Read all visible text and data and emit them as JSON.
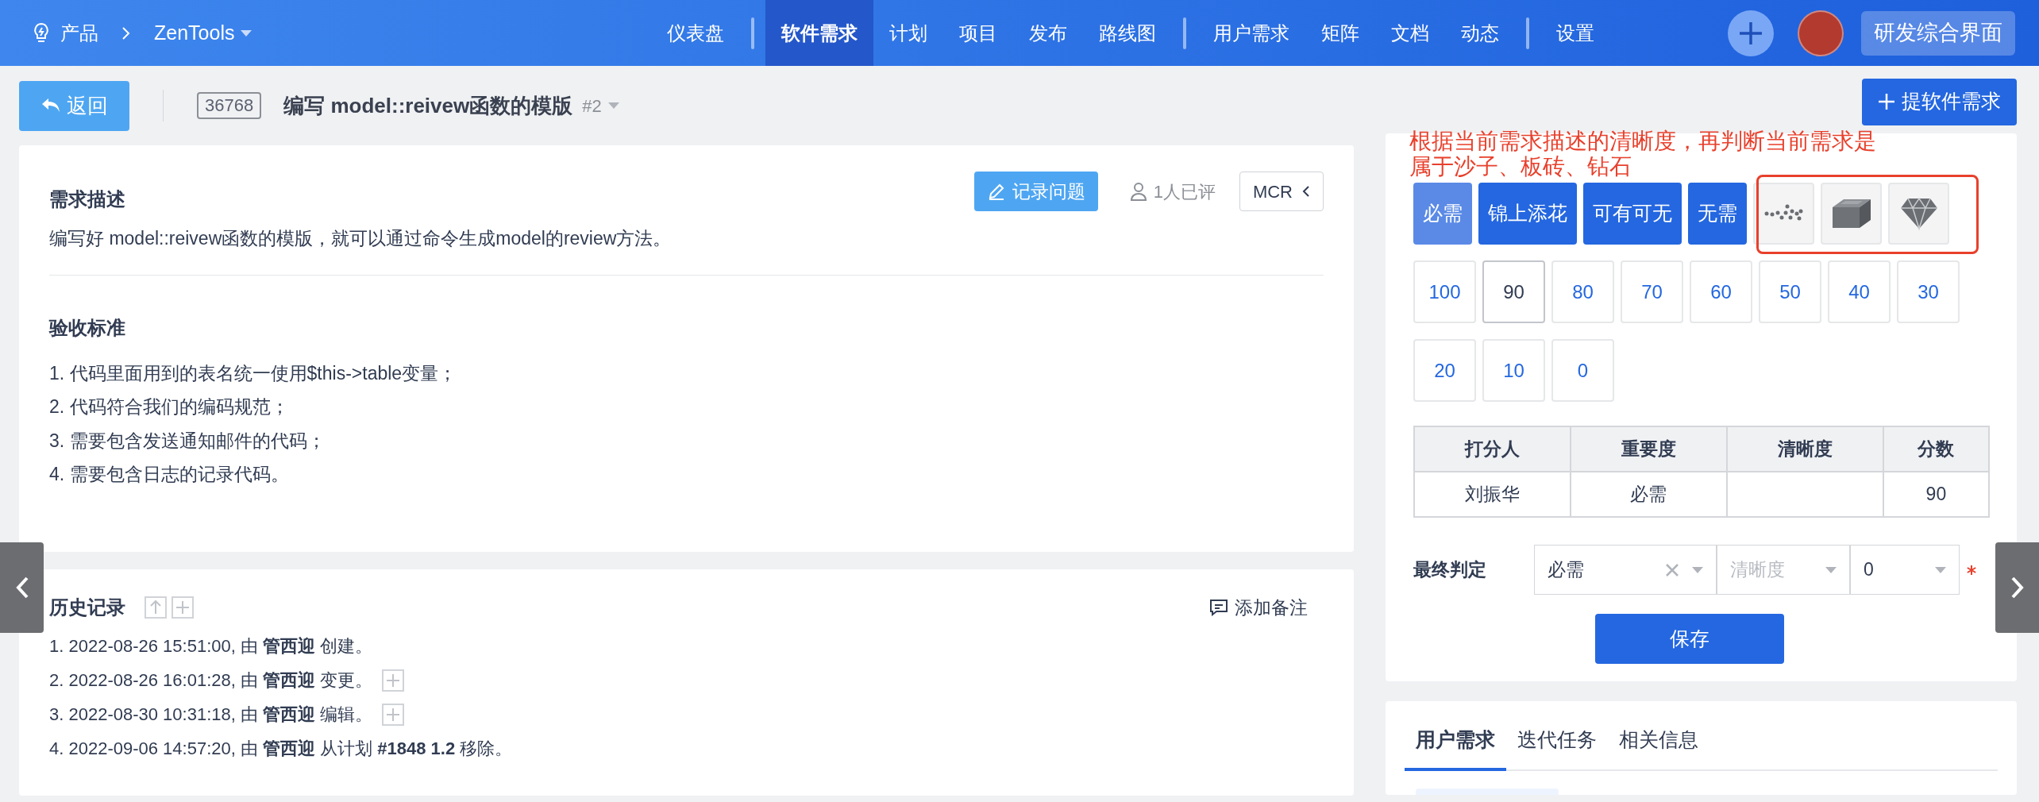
{
  "topbar": {
    "product": "产品",
    "project": "ZenTools",
    "nav_groups": [
      [
        {
          "label": "仪表盘",
          "selected": false
        }
      ],
      [
        {
          "label": "软件需求",
          "selected": true
        },
        {
          "label": "计划",
          "selected": false
        },
        {
          "label": "项目",
          "selected": false
        },
        {
          "label": "发布",
          "selected": false
        },
        {
          "label": "路线图",
          "selected": false
        }
      ],
      [
        {
          "label": "用户需求",
          "selected": false
        },
        {
          "label": "矩阵",
          "selected": false
        },
        {
          "label": "文档",
          "selected": false
        },
        {
          "label": "动态",
          "selected": false
        }
      ],
      [
        {
          "label": "设置",
          "selected": false
        }
      ]
    ],
    "workspace": "研发综合界面"
  },
  "header": {
    "back": "返回",
    "id": "36768",
    "title": "编写 model::reivew函数的模版",
    "version": "#2",
    "create": "提软件需求"
  },
  "annotation": {
    "text": "根据当前需求描述的清晰度，再判断当前需求是属于沙子、板砖、钻石"
  },
  "description": {
    "heading": "需求描述",
    "record_button": "记录问题",
    "reviewed": "1人已评",
    "mcr": "MCR",
    "text": "编写好 model::reivew函数的模版，就可以通过命令生成model的review方法。"
  },
  "acceptance": {
    "heading": "验收标准",
    "items": [
      "1. 代码里面用到的表名统一使用$this->table变量；",
      "2. 代码符合我们的编码规范；",
      "3. 需要包含发送通知邮件的代码；",
      "4. 需要包含日志的记录代码。"
    ]
  },
  "history": {
    "heading": "历史记录",
    "add_note": "添加备注",
    "entries": [
      {
        "text": "1. 2022-08-26 15:51:00, 由 **管西迎** 创建。",
        "expandable": false
      },
      {
        "text": "2. 2022-08-26 16:01:28, 由 **管西迎** 变更。",
        "expandable": true
      },
      {
        "text": "3. 2022-08-30 10:31:18, 由 **管西迎** 编辑。",
        "expandable": true
      },
      {
        "text": "4. 2022-09-06 14:57:20, 由 **管西迎** 从计划 **#1848 1.2** 移除。",
        "expandable": false
      }
    ]
  },
  "importance": [
    {
      "label": "必需",
      "selected": true
    },
    {
      "label": "锦上添花",
      "selected": false
    },
    {
      "label": "可有可无",
      "selected": false
    },
    {
      "label": "无需",
      "selected": false
    }
  ],
  "clarity": [
    {
      "kind": "sand",
      "selected": false
    },
    {
      "kind": "brick",
      "selected": false
    },
    {
      "kind": "diamond",
      "selected": false
    }
  ],
  "scores": [
    {
      "label": "100",
      "selected": false
    },
    {
      "label": "90",
      "selected": true
    },
    {
      "label": "80",
      "selected": false
    },
    {
      "label": "70",
      "selected": false
    },
    {
      "label": "60",
      "selected": false
    },
    {
      "label": "50",
      "selected": false
    },
    {
      "label": "40",
      "selected": false
    },
    {
      "label": "30",
      "selected": false
    },
    {
      "label": "20",
      "selected": false
    },
    {
      "label": "10",
      "selected": false
    },
    {
      "label": "0",
      "selected": false
    }
  ],
  "table": {
    "columns": [
      "打分人",
      "重要度",
      "清晰度",
      "分数"
    ],
    "rows": [
      [
        "刘振华",
        "必需",
        "",
        "90"
      ]
    ]
  },
  "final": {
    "label": "最终判定",
    "importance": "必需",
    "clarity_placeholder": "清晰度",
    "score": "0",
    "required": true,
    "save": "保存"
  },
  "tabs": [
    {
      "label": "用户需求",
      "selected": true
    },
    {
      "label": "迭代任务",
      "selected": false
    },
    {
      "label": "相关信息",
      "selected": false
    }
  ]
}
